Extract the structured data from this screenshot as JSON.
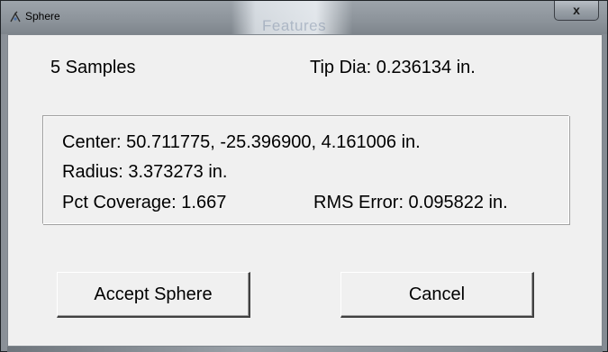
{
  "window": {
    "title": "Sphere",
    "background_title_text": "Features",
    "close_label": "x"
  },
  "summary": {
    "samples": "5 Samples",
    "tip_dia": "Tip Dia: 0.236134 in."
  },
  "results": {
    "center": "Center: 50.711775, -25.396900, 4.161006 in.",
    "radius": "Radius: 3.373273 in.",
    "pct_coverage": "Pct Coverage: 1.667",
    "rms_error": "RMS Error: 0.095822 in."
  },
  "buttons": {
    "accept": "Accept Sphere",
    "cancel": "Cancel"
  },
  "colors": {
    "dialog_face": "#f0f0f0",
    "frame": "#9ca3aa"
  }
}
